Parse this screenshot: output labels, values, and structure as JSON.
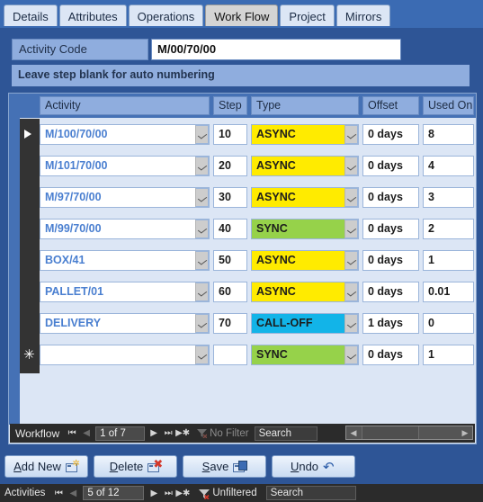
{
  "tabs": [
    {
      "label": "Details",
      "active": false
    },
    {
      "label": "Attributes",
      "active": false
    },
    {
      "label": "Operations",
      "active": false
    },
    {
      "label": "Work Flow",
      "active": true
    },
    {
      "label": "Project",
      "active": false
    },
    {
      "label": "Mirrors",
      "active": false
    }
  ],
  "header": {
    "activity_code_label": "Activity Code",
    "activity_code_value": "M/00/70/00",
    "note": "Leave step blank for auto numbering"
  },
  "grid": {
    "columns": [
      "Activity",
      "Step",
      "Type",
      "Offset",
      "Used On"
    ],
    "rows": [
      {
        "activity": "M/100/70/00",
        "step": "10",
        "type": "ASYNC",
        "type_style": "async",
        "offset": "0 days",
        "used_on": "8",
        "selector": "current"
      },
      {
        "activity": "M/101/70/00",
        "step": "20",
        "type": "ASYNC",
        "type_style": "async",
        "offset": "0 days",
        "used_on": "4",
        "selector": ""
      },
      {
        "activity": "M/97/70/00",
        "step": "30",
        "type": "ASYNC",
        "type_style": "async",
        "offset": "0 days",
        "used_on": "3",
        "selector": ""
      },
      {
        "activity": "M/99/70/00",
        "step": "40",
        "type": "SYNC",
        "type_style": "sync",
        "offset": "0 days",
        "used_on": "2",
        "selector": ""
      },
      {
        "activity": "BOX/41",
        "step": "50",
        "type": "ASYNC",
        "type_style": "async",
        "offset": "0 days",
        "used_on": "1",
        "selector": ""
      },
      {
        "activity": "PALLET/01",
        "step": "60",
        "type": "ASYNC",
        "type_style": "async",
        "offset": "0 days",
        "used_on": "0.01",
        "selector": ""
      },
      {
        "activity": "DELIVERY",
        "step": "70",
        "type": "CALL-OFF",
        "type_style": "calloff",
        "offset": "1 days",
        "used_on": "0",
        "selector": ""
      },
      {
        "activity": "",
        "step": "",
        "type": "SYNC",
        "type_style": "sync",
        "offset": "0 days",
        "used_on": "1",
        "selector": "new"
      }
    ]
  },
  "subform_nav": {
    "label": "Workflow",
    "record": "1 of 7",
    "filter": "No Filter",
    "search_placeholder": "Search"
  },
  "actions": [
    {
      "label": "Add New",
      "accel": "A",
      "rest": "dd New",
      "icon": "new-record-icon"
    },
    {
      "label": "Delete",
      "accel": "D",
      "rest": "elete",
      "icon": "delete-record-icon"
    },
    {
      "label": "Save",
      "accel": "S",
      "rest": "ave",
      "icon": "save-record-icon"
    },
    {
      "label": "Undo",
      "accel": "U",
      "rest": "ndo",
      "icon": "undo-icon"
    }
  ],
  "statusbar": {
    "label": "Activities",
    "record": "5 of 12",
    "filter": "Unfiltered",
    "search_placeholder": "Search"
  },
  "colors": {
    "form_background": "#2e5596",
    "tab_active": "#d4d4d4",
    "tab_inactive": "#dce6f5",
    "label_fill": "#8fadde",
    "async": "#ffeb00",
    "sync": "#96d24a",
    "calloff": "#12b4e8",
    "activity_text": "#4a7fd0",
    "selection": "#5a9bd5"
  }
}
